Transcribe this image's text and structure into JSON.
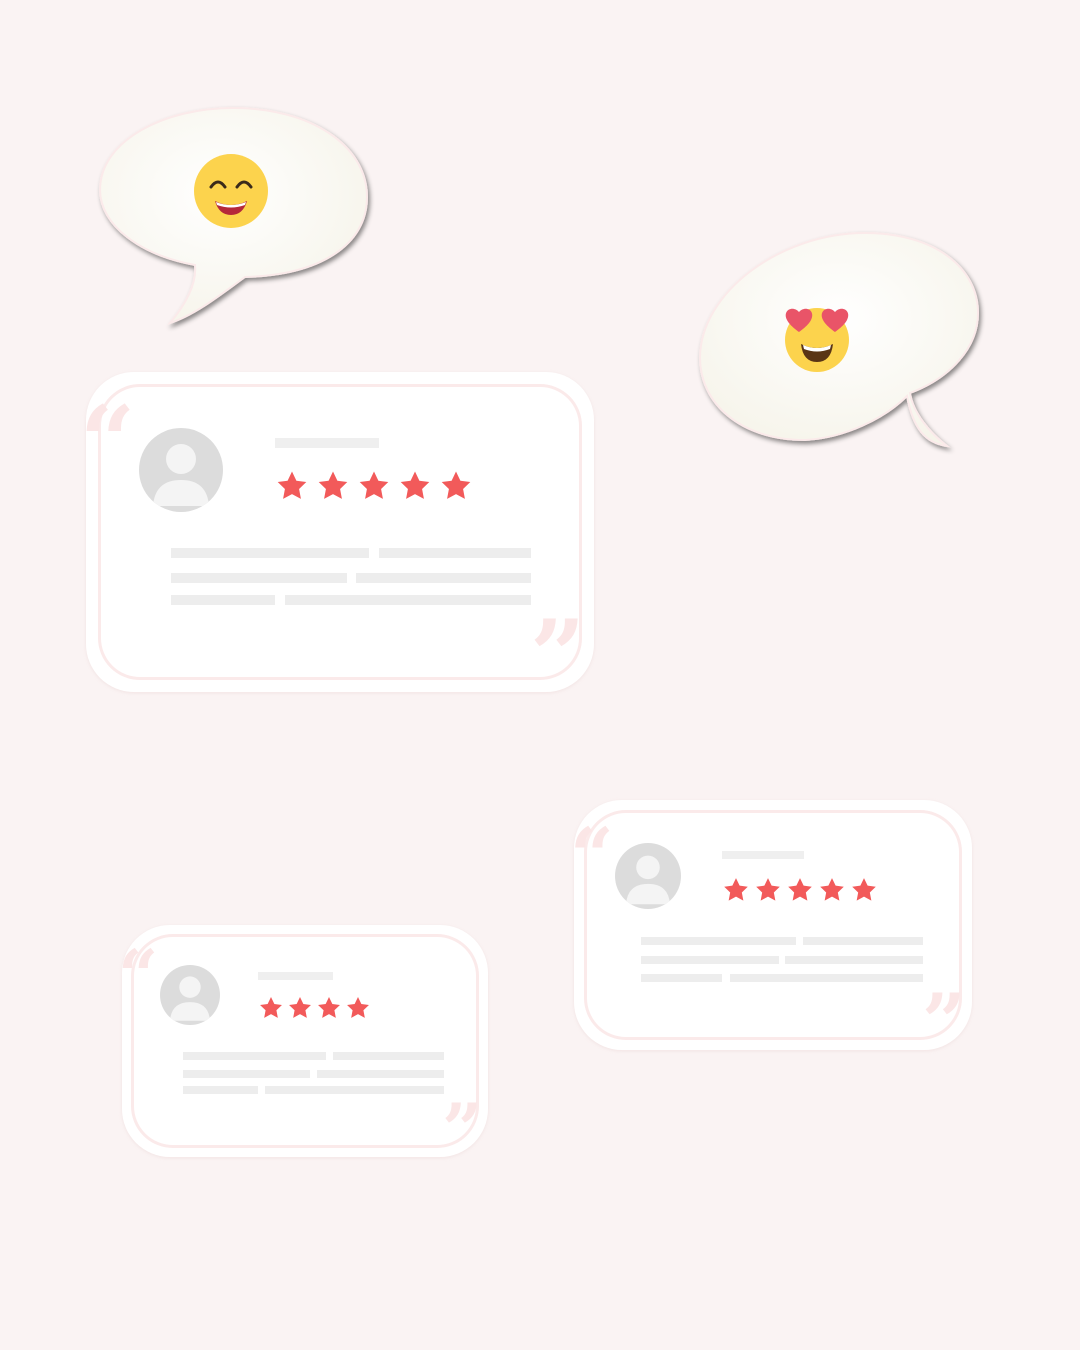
{
  "colors": {
    "background": "#faf3f3",
    "card": "#ffffff",
    "card_border": "#fbeaea",
    "star": "#f25a5a",
    "placeholder": "#ededed",
    "avatar": "#dcdcdc",
    "emoji_face": "#fcd34d",
    "heart": "#e95468"
  },
  "bubbles": [
    {
      "emoji": "grinning-face-with-smiling-eyes-icon"
    },
    {
      "emoji": "smiling-face-with-heart-eyes-icon"
    }
  ],
  "reviews": [
    {
      "avatar": "user-avatar-icon",
      "rating": 5,
      "open_quote": "“",
      "close_quote": "”"
    },
    {
      "avatar": "user-avatar-icon",
      "rating": 5,
      "open_quote": "“",
      "close_quote": "”"
    },
    {
      "avatar": "user-avatar-icon",
      "rating": 4,
      "open_quote": "“",
      "close_quote": "”"
    }
  ]
}
